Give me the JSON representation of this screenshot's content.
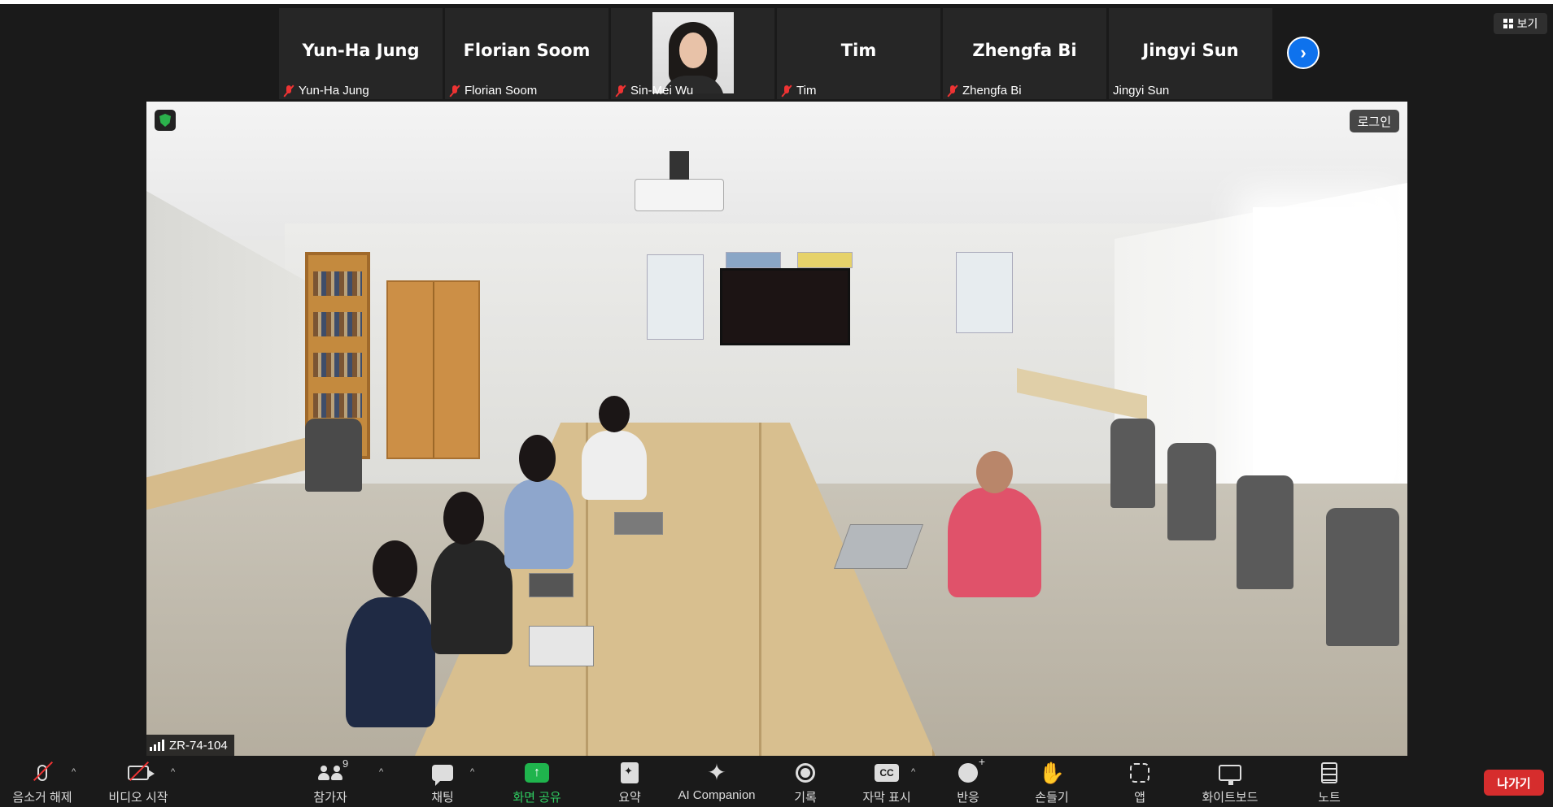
{
  "gallery": {
    "tiles": [
      {
        "display_name": "Yun-Ha Jung",
        "label": "Yun-Ha Jung",
        "muted": true
      },
      {
        "display_name": "Florian Soom",
        "label": "Florian Soom",
        "muted": true
      },
      {
        "display_name": "",
        "label": "Sin-Mei Wu",
        "muted": true
      },
      {
        "display_name": "Tim",
        "label": "Tim",
        "muted": true
      },
      {
        "display_name": "Zhengfa Bi",
        "label": "Zhengfa Bi",
        "muted": true
      },
      {
        "display_name": "Jingyi Sun",
        "label": "Jingyi Sun",
        "muted": false
      }
    ],
    "next_icon": "chevron-right-icon"
  },
  "view_button": {
    "label": "보기",
    "icon": "grid-icon"
  },
  "main_video": {
    "login_label": "로그인",
    "room_name": "ZR-74-104",
    "security_icon": "shield-icon",
    "signal_icon": "signal-bars-icon"
  },
  "toolbar": {
    "unmute": {
      "label": "음소거 해제",
      "icon": "mic-off-icon"
    },
    "start_video": {
      "label": "비디오 시작",
      "icon": "video-off-icon"
    },
    "participants": {
      "label": "참가자",
      "count": "9",
      "icon": "participants-icon"
    },
    "chat": {
      "label": "채팅",
      "icon": "chat-icon"
    },
    "share_screen": {
      "label": "화면 공유",
      "icon": "share-screen-icon"
    },
    "summary": {
      "label": "요약",
      "icon": "summary-icon"
    },
    "ai_companion": {
      "label": "AI Companion",
      "icon": "sparkle-icon"
    },
    "record": {
      "label": "기록",
      "icon": "record-icon"
    },
    "captions": {
      "label": "자막 표시",
      "icon": "cc-icon"
    },
    "reactions": {
      "label": "반응",
      "icon": "emoji-icon"
    },
    "raise_hand": {
      "label": "손들기",
      "icon": "hand-icon"
    },
    "apps": {
      "label": "앱",
      "icon": "apps-icon"
    },
    "whiteboard": {
      "label": "화이트보드",
      "icon": "whiteboard-icon"
    },
    "notes": {
      "label": "노트",
      "icon": "notes-icon"
    },
    "leave": {
      "label": "나가기"
    }
  },
  "colors": {
    "background": "#1a1a1a",
    "accent_blue": "#0e72ed",
    "share_green": "#1fb44d",
    "leave_red": "#d62d2d",
    "muted_red": "#e33333"
  }
}
